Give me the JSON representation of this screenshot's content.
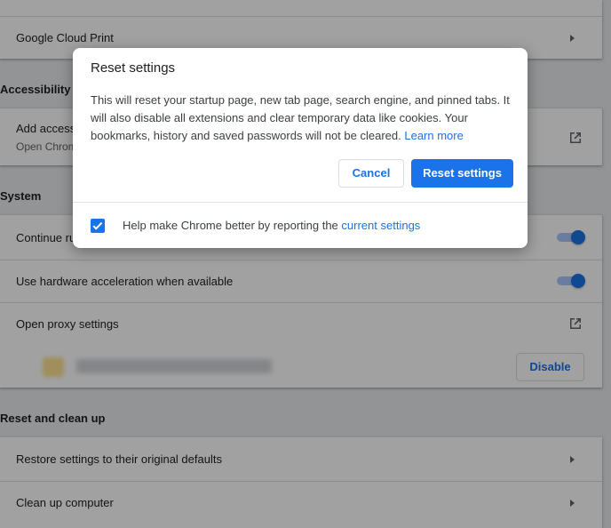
{
  "background": {
    "rows": {
      "google_cloud_print": "Google Cloud Print",
      "add_accessibility_title": "Add accessibility features",
      "add_accessibility_sub": "Open Chrome Web Store",
      "continue_running": "Continue running background apps when Google Chrome is closed",
      "hardware_accel": "Use hardware acceleration when available",
      "open_proxy": "Open proxy settings",
      "restore_settings": "Restore settings to their original defaults",
      "clean_up": "Clean up computer"
    },
    "sections": {
      "accessibility": "Accessibility",
      "system": "System",
      "reset_clean": "Reset and clean up"
    },
    "disable_button": "Disable",
    "toggles": {
      "continue_running": true,
      "hardware_accel": true
    }
  },
  "dialog": {
    "title": "Reset settings",
    "body_text": "This will reset your startup page, new tab page, search engine, and pinned tabs. It will also disable all extensions and clear temporary data like cookies. Your bookmarks, history and saved passwords will not be cleared.",
    "learn_more": "Learn more",
    "cancel_label": "Cancel",
    "reset_label": "Reset settings",
    "checkbox_checked": true,
    "footer_text": "Help make Chrome better by reporting the",
    "footer_link": "current settings"
  },
  "colors": {
    "accent": "#1a73e8",
    "overlay": "rgba(0,0,0,0.37)"
  }
}
